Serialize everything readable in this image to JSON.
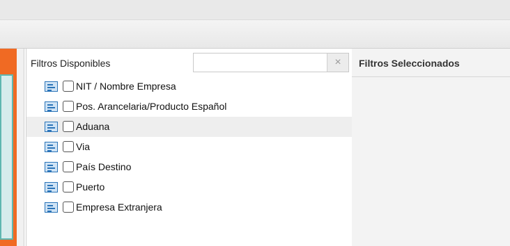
{
  "available_panel": {
    "title": "Filtros Disponibles",
    "search": {
      "value": "",
      "placeholder": ""
    },
    "clear_icon": "close-icon",
    "items": [
      {
        "label": "NIT / Nombre Empresa",
        "checked": false,
        "icon": "list-icon"
      },
      {
        "label": "Pos. Arancelaria/Producto Español",
        "checked": false,
        "icon": "list-icon"
      },
      {
        "label": "Aduana",
        "checked": false,
        "icon": "list-icon",
        "highlighted": true
      },
      {
        "label": "Via",
        "checked": false,
        "icon": "list-icon"
      },
      {
        "label": "País Destino",
        "checked": false,
        "icon": "list-icon"
      },
      {
        "label": "Puerto",
        "checked": false,
        "icon": "list-icon"
      },
      {
        "label": "Empresa Extranjera",
        "checked": false,
        "icon": "list-icon"
      }
    ]
  },
  "selected_panel": {
    "title": "Filtros Seleccionados"
  },
  "colors": {
    "accent_orange": "#f06a23",
    "accent_teal": "#5fb7b0",
    "icon_blue": "#2b74b8"
  }
}
